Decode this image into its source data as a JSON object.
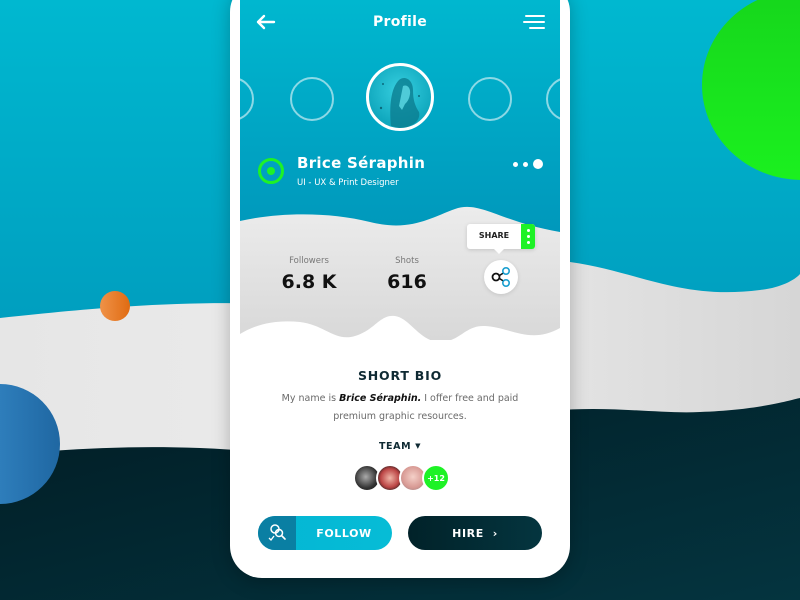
{
  "header": {
    "title": "Profile",
    "back_icon": "arrow-left-icon",
    "menu_icon": "hamburger-menu-icon"
  },
  "profile": {
    "name": "Brice Séraphin",
    "role": "UI - UX & Print Designer",
    "status": "online",
    "carousel_pages": 3,
    "carousel_active_page": 3
  },
  "stats": [
    {
      "label": "Followers",
      "value": "6.8 K"
    },
    {
      "label": "Shots",
      "value": "616"
    }
  ],
  "share": {
    "label": "SHARE",
    "icon": "share-icon",
    "more_icon": "kebab-icon"
  },
  "bio": {
    "title": "SHORT BIO",
    "prefix": "My name is ",
    "name": "Brice Séraphin.",
    "suffix": " I offer free and paid premium graphic resources."
  },
  "team": {
    "label": "TEAM",
    "members": 3,
    "more_count": "+12"
  },
  "actions": {
    "follow_label": "FOLLOW",
    "hire_label": "HIRE",
    "hire_chevron": "›"
  },
  "colors": {
    "primary": "#00b8cf",
    "accent_green": "#1ef226",
    "dark": "#012229",
    "orange": "#e8792a",
    "blue": "#2f7fbf"
  }
}
